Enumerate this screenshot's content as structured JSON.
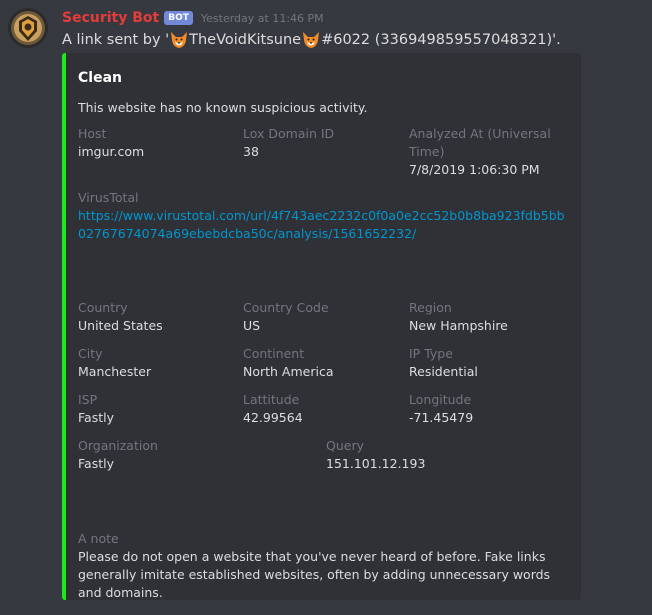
{
  "message": {
    "username": "Security Bot",
    "bot_tag": "BOT",
    "timestamp": "Yesterday at 11:46 PM",
    "content": {
      "prefix": "A link sent by '",
      "user_name": "TheVoidKitsune",
      "suffix": "#6022 (336949859557048321)'."
    }
  },
  "embed": {
    "accent_color": "#1de81d",
    "title": "Clean",
    "description": "This website has no known suspicious activity.",
    "fields": {
      "host": {
        "name": "Host",
        "value": "imgur.com"
      },
      "lox_domain_id": {
        "name": "Lox Domain ID",
        "value": "38"
      },
      "analyzed_at": {
        "name": "Analyzed At (Universal Time)",
        "value": "7/8/2019 1:06:30 PM"
      },
      "virustotal": {
        "name": "VirusTotal",
        "value": "https://www.virustotal.com/url/4f743aec2232c0f0a0e2cc52b0b8ba923fdb5bb02767674074a69ebebdcba50c/analysis/1561652232/"
      },
      "country": {
        "name": "Country",
        "value": "United States"
      },
      "country_code": {
        "name": "Country Code",
        "value": "US"
      },
      "region": {
        "name": "Region",
        "value": "New Hampshire"
      },
      "city": {
        "name": "City",
        "value": "Manchester"
      },
      "continent": {
        "name": "Continent",
        "value": "North America"
      },
      "ip_type": {
        "name": "IP Type",
        "value": "Residential"
      },
      "isp": {
        "name": "ISP",
        "value": "Fastly"
      },
      "latitude": {
        "name": "Lattitude",
        "value": "42.99564"
      },
      "longitude": {
        "name": "Longitude",
        "value": "-71.45479"
      },
      "organization": {
        "name": "Organization",
        "value": "Fastly"
      },
      "query": {
        "name": "Query",
        "value": "151.101.12.193"
      },
      "note": {
        "name": "A note",
        "value": "Please do not open a website that you've never heard of before. Fake links generally imitate established websites, often by adding unnecessary words and domains."
      }
    }
  },
  "icons": [
    "bot-avatar-icon",
    "fox-emoji-icon"
  ],
  "colors": {
    "background": "#36393f",
    "embed_background": "#2f3136",
    "username": "#e63b3b",
    "link": "#0096cf"
  }
}
